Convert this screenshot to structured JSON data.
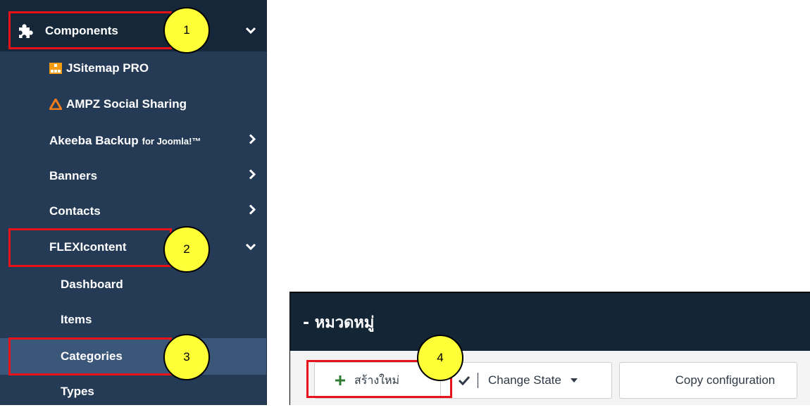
{
  "sidebar": {
    "components": {
      "label": "Components",
      "callout": "1"
    },
    "items": [
      {
        "label": "JSitemap PRO"
      },
      {
        "label": "AMPZ Social Sharing"
      },
      {
        "label": "Akeeba Backup",
        "suffix": "for Joomla!™"
      },
      {
        "label": "Banners"
      },
      {
        "label": "Contacts"
      }
    ],
    "flexicontent": {
      "label": "FLEXIcontent",
      "callout": "2"
    },
    "subitems": [
      {
        "label": "Dashboard"
      },
      {
        "label": "Items"
      },
      {
        "label": "Categories",
        "callout": "3"
      },
      {
        "label": "Types"
      }
    ]
  },
  "panel": {
    "title": "- หมวดหมู่",
    "new_button": "สร้างใหม่",
    "new_callout": "4",
    "change_state": "Change State",
    "copy_config": "Copy configuration"
  },
  "colors": {
    "sidebar_bg": "#243a55",
    "active_bg": "#3a5679",
    "highlight": "#e8121b",
    "callout": "#ffff38",
    "plus_green": "#2e7d32"
  }
}
